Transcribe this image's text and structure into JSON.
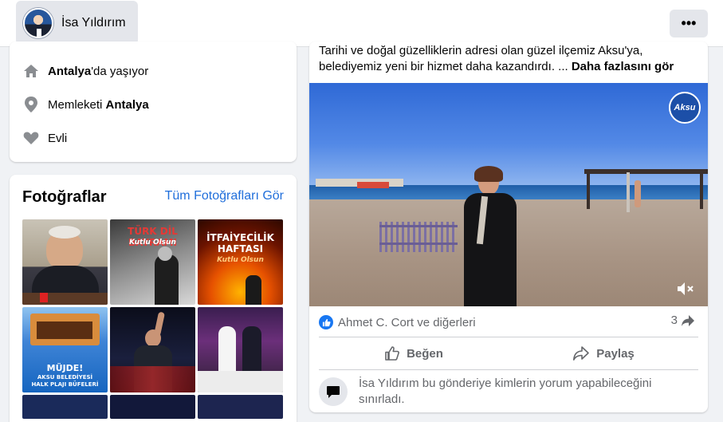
{
  "header": {
    "profile_name": "İsa Yıldırım",
    "more_label": "•••"
  },
  "intro": {
    "lives_prefix": "",
    "lives_city": "Antalya",
    "lives_suffix": "'da yaşıyor",
    "hometown_prefix": "Memleketi ",
    "hometown_city": "Antalya",
    "relationship": "Evli",
    "icons": [
      "home-icon",
      "location-pin-icon",
      "heart-icon"
    ]
  },
  "photos": {
    "title": "Fotoğraflar",
    "see_all": "Tüm Fotoğrafları Gör",
    "tiles": [
      {
        "name": "photo-office-portrait",
        "caption": ""
      },
      {
        "name": "photo-turk-dil-bayrami",
        "caption": "TÜRK DİL BAYRAMI",
        "sub": "Kutlu Olsun"
      },
      {
        "name": "photo-itfaiyecilik-haftasi",
        "caption": "İTFAİYECİLİK HAFTASI",
        "sub": "Kutlu Olsun"
      },
      {
        "name": "photo-halk-plaji-bufeleri",
        "caption": "MÜJDE!",
        "sub": "AKSU BELEDİYESİ HALK PLAJI BÜFELERİ"
      },
      {
        "name": "photo-speech-waving",
        "caption": ""
      },
      {
        "name": "photo-wedding-ceremony",
        "caption": ""
      }
    ]
  },
  "post": {
    "text_line1": "Tarihi ve doğal güzelliklerin adresi olan güzel ilçemiz Aksu'ya,",
    "text_line2": "belediyemiz yeni bir hizmet daha kazandırdı. ...",
    "see_more": "Daha fazlasını gör",
    "video_logo": "Aksu",
    "reactions_text": "Ahmet C. Cort ve diğerleri",
    "share_count": "3",
    "like_label": "Beğen",
    "share_label": "Paylaş",
    "comment_restriction": "İsa Yıldırım bu gönderiye kimlerin yorum yapabileceğini sınırladı."
  },
  "colors": {
    "accent": "#1877f2",
    "link": "#216fdb",
    "muted": "#65676b",
    "background": "#f0f2f5"
  }
}
